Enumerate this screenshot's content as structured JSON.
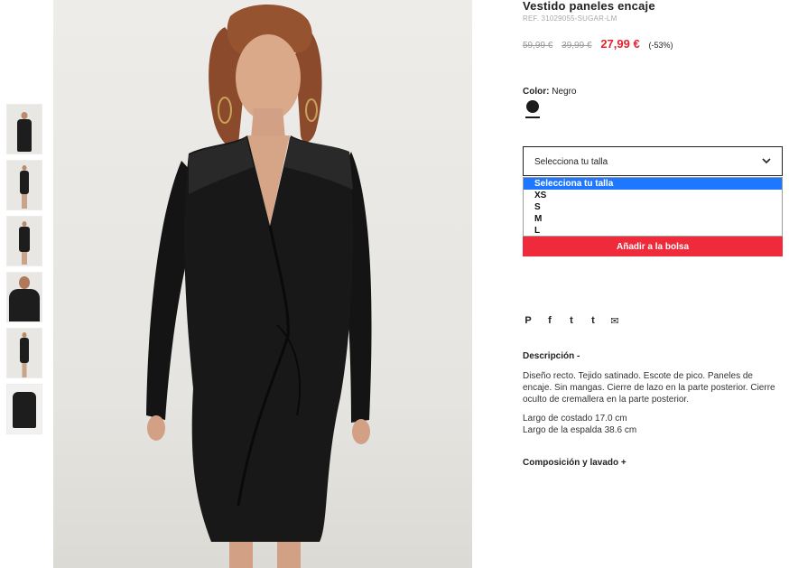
{
  "product": {
    "title": "Vestido paneles encaje",
    "ref": "REF. 31029055-SUGAR-LM",
    "price_original": "59,99 €",
    "price_previous": "39,99 €",
    "price_sale": "27,99 €",
    "discount": "(-53%)"
  },
  "color": {
    "label": "Color:",
    "value": "Negro",
    "swatch_hex": "#1c1c1c"
  },
  "size_select": {
    "current": "Selecciona tu talla",
    "options": [
      "Selecciona tu talla",
      "XS",
      "S",
      "M",
      "L"
    ],
    "highlighted_option": "Selecciona tu talla",
    "highlight_color": "#1e78ff"
  },
  "add_to_bag": {
    "label": "Añadir a la bolsa",
    "color": "#ee2a3b"
  },
  "share": {
    "icons": [
      "pinterest-icon",
      "facebook-icon",
      "twitter-icon",
      "tumblr-icon",
      "email-icon"
    ],
    "glyphs": [
      "P",
      "f",
      "t",
      "t",
      "✉"
    ]
  },
  "description": {
    "heading": "Descripción -",
    "text1": "Diseño recto. Tejido satinado. Escote de pico. Paneles de encaje. Sin mangas. Cierre de lazo en la parte posterior. Cierre oculto de cremallera en la parte posterior.",
    "line_largo_costado": "Largo de costado 17.0 cm",
    "line_largo_espalda": "Largo de la espalda 38.6 cm"
  },
  "composition": {
    "heading": "Composición y lavado +"
  },
  "thumbnails": [
    "thumbnail-1",
    "thumbnail-2",
    "thumbnail-3",
    "thumbnail-4",
    "thumbnail-5",
    "thumbnail-6"
  ]
}
